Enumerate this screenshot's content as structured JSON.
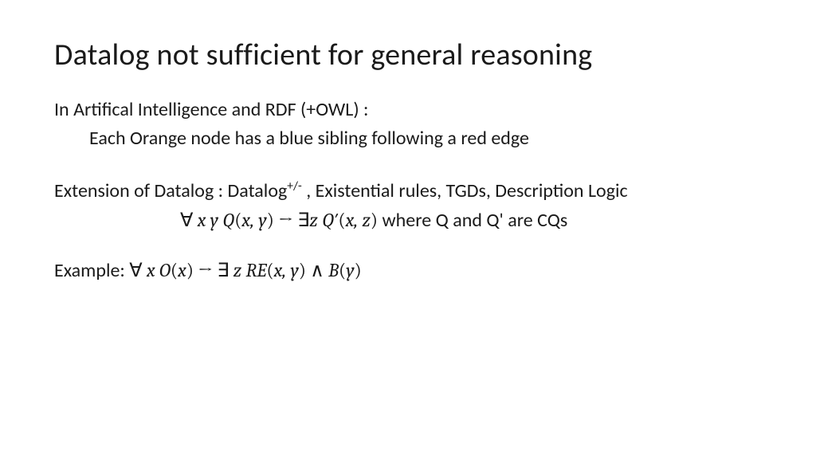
{
  "title": "Datalog not sufficient for general reasoning",
  "line1": "In Artifical Intelligence and RDF (+OWL) :",
  "line2": "Each Orange node has a blue sibling following a red edge",
  "ext_prefix": "Extension of Datalog : Datalog",
  "ext_sup": "+/-",
  "ext_suffix": " , Existential rules, TGDs, Description Logic",
  "formula_forall": "∀ ",
  "formula_xy": "x y",
  "formula_Q": " Q",
  "formula_args1_open": "(",
  "formula_args1": "x, y",
  "formula_args1_close": ")",
  "formula_arrow": "  → ∃",
  "formula_z": "z",
  "formula_Qp": " Q′",
  "formula_args2_open": "(",
  "formula_args2": "x, z",
  "formula_args2_close": ")",
  "formula_tail": " where Q and Q' are CQs",
  "example_label": "Example: ",
  "ex_forall": "∀ ",
  "ex_x": "x",
  "ex_O": " O",
  "ex_po": "(",
  "ex_ox": "x",
  "ex_pc": ")",
  "ex_arrow": " →  ∃ ",
  "ex_z": "z",
  "ex_RE": " RE",
  "ex_p2o": "(",
  "ex_xy": "x, y",
  "ex_p2c": ")",
  "ex_and": " ∧ ",
  "ex_B": "B",
  "ex_p3o": "(",
  "ex_y": "y",
  "ex_p3c": ")"
}
